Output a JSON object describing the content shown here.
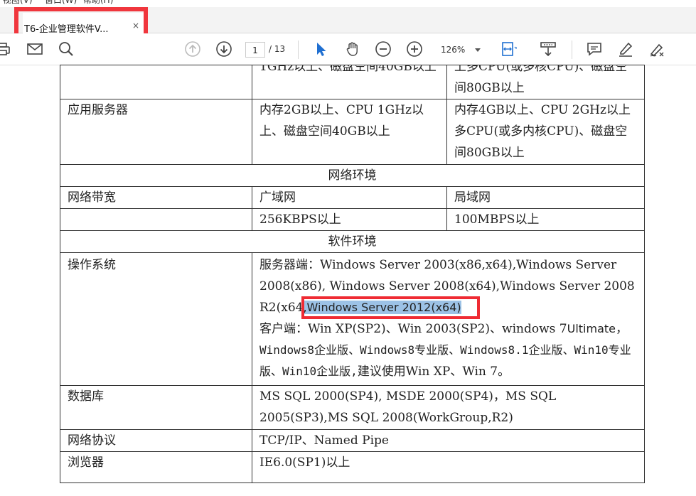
{
  "menu": {
    "items": [
      "视图(V)",
      "窗口(W)",
      "帮助(H)"
    ]
  },
  "tab": {
    "title": "T6-企业管理软件V...",
    "close": "×"
  },
  "toolbar": {
    "page_current": "1",
    "page_total": "/ 13",
    "zoom": "126%",
    "icons": [
      "print-icon",
      "email-icon",
      "search-icon",
      "prev-page-icon",
      "next-page-icon",
      "select-icon",
      "hand-icon",
      "zoom-out-icon",
      "zoom-in-icon",
      "fit-page-icon",
      "scroll-mode-icon",
      "comment-icon",
      "highlight-icon",
      "sign-icon"
    ]
  },
  "table": {
    "row_top": {
      "c2": "1GHz以上、磁盘空间40GB以上",
      "c3": "上多CPU(或多核CPU)、磁盘空间80GB以上"
    },
    "app_server": {
      "label": "应用服务器",
      "c2": "内存2GB以上、CPU 1GHz以上、磁盘空间40GB以上",
      "c3": "内存4GB以上、CPU 2GHz以上多CPU(或多内核CPU)、磁盘空间80GB以上"
    },
    "network_env": "网络环境",
    "bandwidth": {
      "label": "网络带宽",
      "c2": "广域网",
      "c3": "局域网",
      "c2b": "256KBPS以上",
      "c3b": "100MBPS以上"
    },
    "software_env": "软件环境",
    "os": {
      "label": "操作系统",
      "line1": "服务器端：Windows Server 2003(x86,x64),Windows Server 2008(x86), Windows Server 2008(x64),Windows Server 2008 R2(x64",
      "highlight": ",Windows Server 2012(x64)",
      "line2a": "客户端：Win XP(SP2)、Win 2003(SP2)、windows 7",
      "line2b": "Ultimate",
      "line2c": "，",
      "line3": "Windows8企业版、Windows8专业版、Windows8.1企业版、Win10专业版、Win10企业版,",
      "line4": "建议使用Win XP、Win 7。"
    },
    "db": {
      "label": "数据库",
      "value": "MS SQL 2000(SP4), MSDE 2000(SP4)，MS SQL 2005(SP3),MS SQL 2008(WorkGroup,R2)"
    },
    "protocol": {
      "label": "网络协议",
      "value": "TCP/IP、Named Pipe"
    },
    "browser": {
      "label": "浏览器",
      "value": "IE6.0(SP1)以上"
    }
  }
}
